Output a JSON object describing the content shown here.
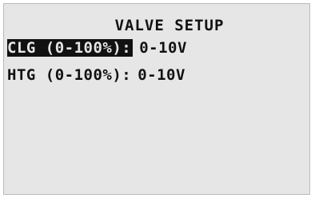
{
  "screen": {
    "title": "VALVE SETUP",
    "rows": [
      {
        "label": "CLG (0-100%):",
        "value": "0-10V",
        "selected": true
      },
      {
        "label": "HTG (0-100%):",
        "value": "0-10V",
        "selected": false
      }
    ]
  },
  "colors": {
    "background": "#e6e6e6",
    "text": "#111111",
    "highlight": "#111111"
  }
}
